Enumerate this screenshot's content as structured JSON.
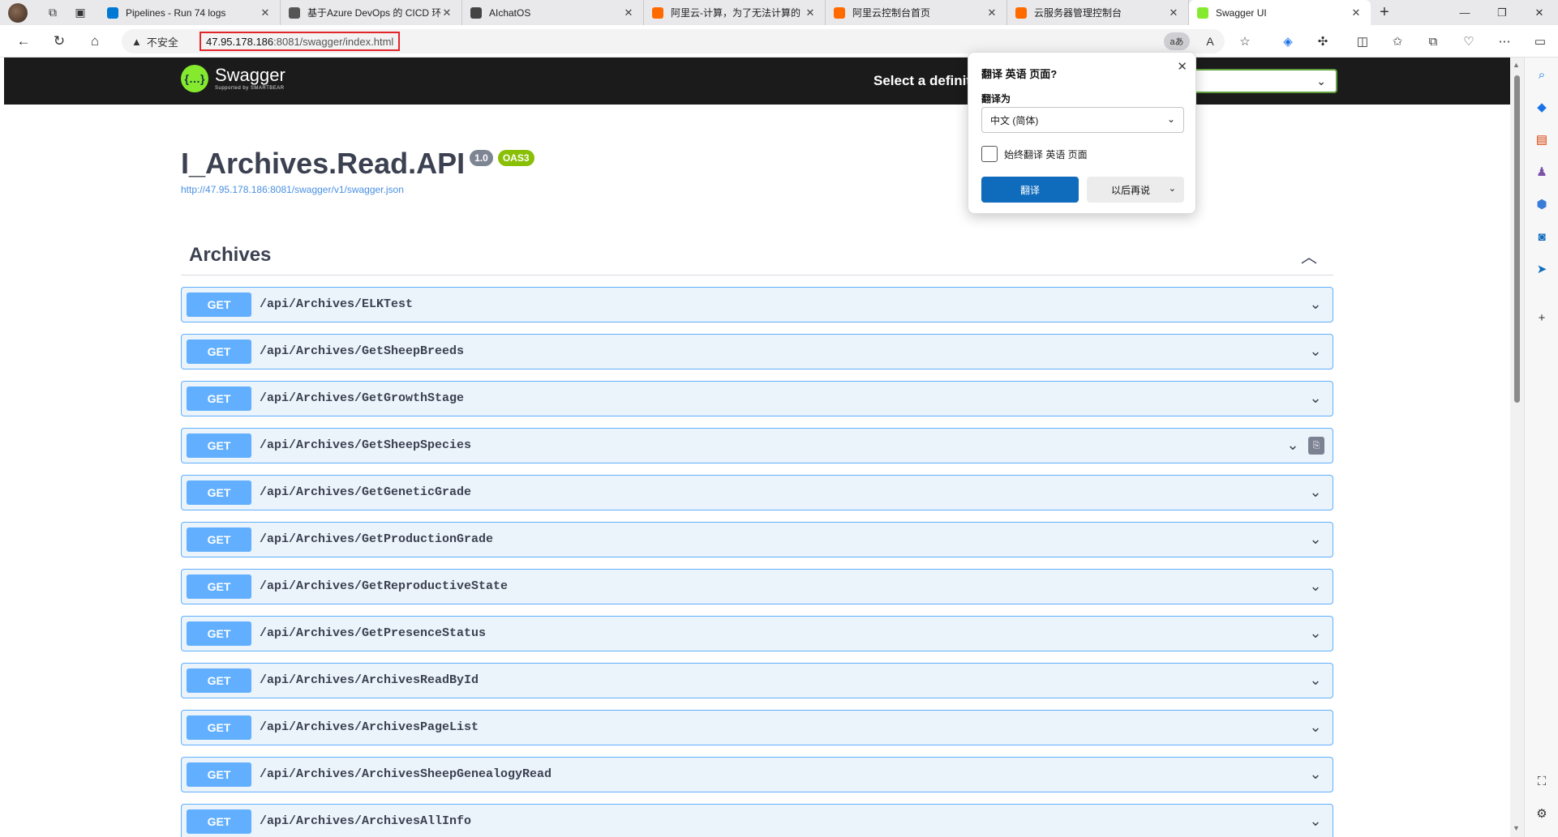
{
  "tabs": [
    {
      "title": "Pipelines - Run 74 logs",
      "icon": "azure-devops-icon",
      "color": "#0078d4"
    },
    {
      "title": "基于Azure DevOps 的 CICD 环",
      "icon": "devops-doc-icon",
      "color": "#555555"
    },
    {
      "title": "AIchatOS",
      "icon": "openai-icon",
      "color": "#444444"
    },
    {
      "title": "阿里云-计算，为了无法计算的",
      "icon": "aliyun-icon",
      "color": "#ff6a00"
    },
    {
      "title": "阿里云控制台首页",
      "icon": "aliyun-icon",
      "color": "#ff6a00"
    },
    {
      "title": "云服务器管理控制台",
      "icon": "aliyun-icon",
      "color": "#ff6a00"
    },
    {
      "title": "Swagger UI",
      "icon": "swagger-icon",
      "color": "#85ea2d",
      "active": true
    }
  ],
  "address": {
    "security": "不安全",
    "url_host": "47.95.178.186",
    "url_path": ":8081/swagger/index.html",
    "translate_badge": "aあ"
  },
  "swagger": {
    "logo_name": "Swagger",
    "logo_sub": "Supported by SMARTBEAR",
    "select_label": "Select a definition",
    "api_title": "I_Archives.Read.API",
    "version": "1.0",
    "oas": "OAS3",
    "spec_url": "http://47.95.178.186:8081/swagger/v1/swagger.json",
    "section": "Archives",
    "method": "GET",
    "operations": [
      "/api/Archives/ELKTest",
      "/api/Archives/GetSheepBreeds",
      "/api/Archives/GetGrowthStage",
      "/api/Archives/GetSheepSpecies",
      "/api/Archives/GetGeneticGrade",
      "/api/Archives/GetProductionGrade",
      "/api/Archives/GetReproductiveState",
      "/api/Archives/GetPresenceStatus",
      "/api/Archives/ArchivesReadById",
      "/api/Archives/ArchivesPageList",
      "/api/Archives/ArchivesSheepGenealogyRead",
      "/api/Archives/ArchivesAllInfo"
    ]
  },
  "translate_popup": {
    "title": "翻译 英语 页面?",
    "label": "翻译为",
    "selected_language": "中文 (简体)",
    "always_label": "始终翻译 英语 页面",
    "translate_button": "翻译",
    "later_button": "以后再说"
  },
  "colors": {
    "get_method": "#61affe",
    "get_background": "#ebf3fb",
    "swagger_green": "#85ea2d",
    "primary_button": "#0f6cbd"
  }
}
